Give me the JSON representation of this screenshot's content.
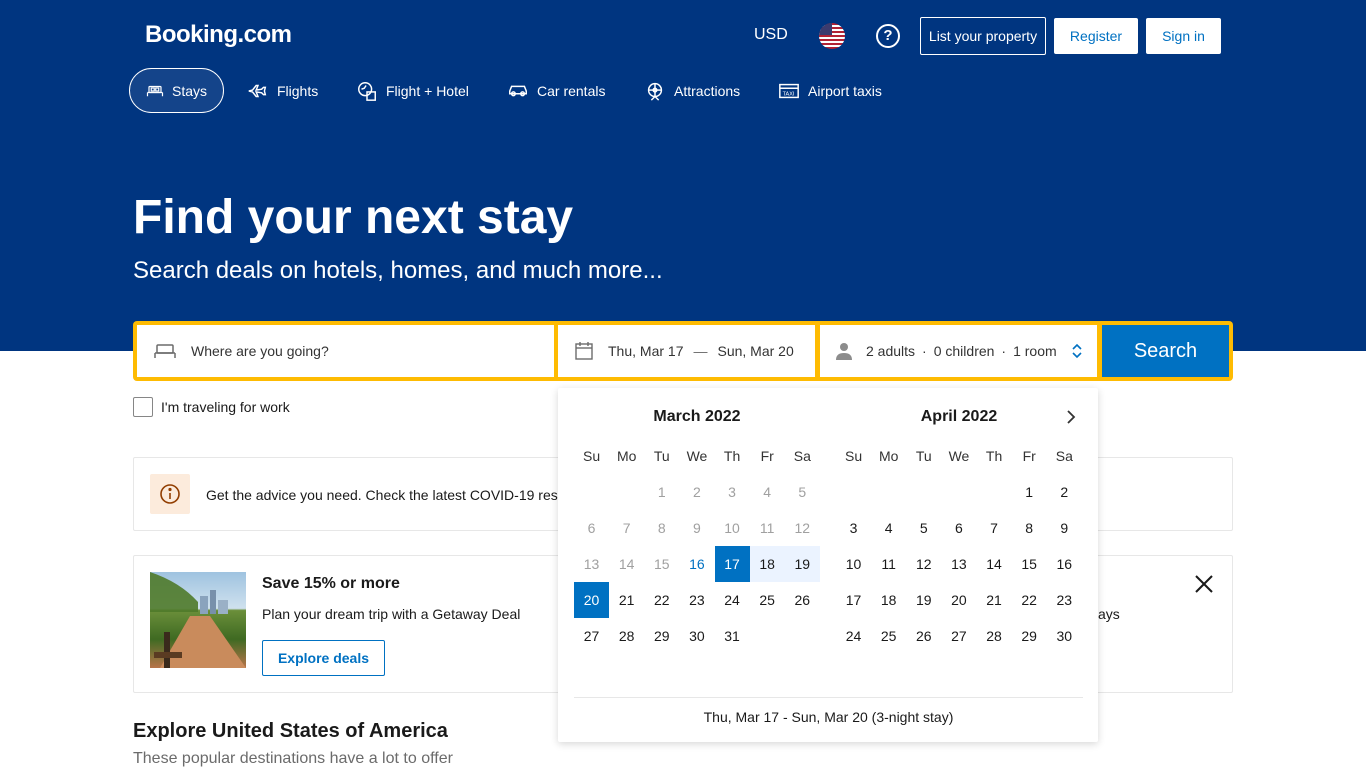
{
  "header": {
    "logo": "Booking.com",
    "currency": "USD",
    "list_property": "List your property",
    "register": "Register",
    "sign_in": "Sign in"
  },
  "nav": [
    {
      "label": "Stays",
      "icon": "bed-icon"
    },
    {
      "label": "Flights",
      "icon": "plane-icon"
    },
    {
      "label": "Flight + Hotel",
      "icon": "flight-hotel-icon"
    },
    {
      "label": "Car rentals",
      "icon": "car-icon"
    },
    {
      "label": "Attractions",
      "icon": "attractions-icon"
    },
    {
      "label": "Airport taxis",
      "icon": "taxi-icon"
    }
  ],
  "hero": {
    "title": "Find your next stay",
    "subtitle": "Search deals on hotels, homes, and much more..."
  },
  "search": {
    "destination_placeholder": "Where are you going?",
    "checkin": "Thu, Mar 17",
    "dash": "—",
    "checkout": "Sun, Mar 20",
    "adults": "2 adults",
    "children": "0 children",
    "rooms": "1 room",
    "sep": "·",
    "button": "Search"
  },
  "work_travel": "I'm traveling for work",
  "notice": "Get the advice you need. Check the latest COVID-19 res",
  "promo": {
    "title": "Save 15% or more",
    "desc": "Plan your dream trip with a Getaway Deal",
    "button": "Explore deals",
    "trailing": "ays"
  },
  "explore": {
    "title": "Explore United States of America",
    "subtitle": "These popular destinations have a lot to offer"
  },
  "calendar": {
    "dow": [
      "Su",
      "Mo",
      "Tu",
      "We",
      "Th",
      "Fr",
      "Sa"
    ],
    "months": [
      {
        "title": "March 2022",
        "weeks": [
          [
            "",
            "",
            "1",
            "2",
            "3",
            "4",
            "5"
          ],
          [
            "6",
            "7",
            "8",
            "9",
            "10",
            "11",
            "12"
          ],
          [
            "13",
            "14",
            "15",
            "16",
            "17",
            "18",
            "19"
          ],
          [
            "20",
            "21",
            "22",
            "23",
            "24",
            "25",
            "26"
          ],
          [
            "27",
            "28",
            "29",
            "30",
            "31",
            "",
            ""
          ]
        ]
      },
      {
        "title": "April 2022",
        "weeks": [
          [
            "",
            "",
            "",
            "",
            "",
            "1",
            "2"
          ],
          [
            "3",
            "4",
            "5",
            "6",
            "7",
            "8",
            "9"
          ],
          [
            "10",
            "11",
            "12",
            "13",
            "14",
            "15",
            "16"
          ],
          [
            "17",
            "18",
            "19",
            "20",
            "21",
            "22",
            "23"
          ],
          [
            "24",
            "25",
            "26",
            "27",
            "28",
            "29",
            "30"
          ]
        ]
      }
    ],
    "footer": "Thu, Mar 17 - Sun, Mar 20 (3-night stay)"
  }
}
